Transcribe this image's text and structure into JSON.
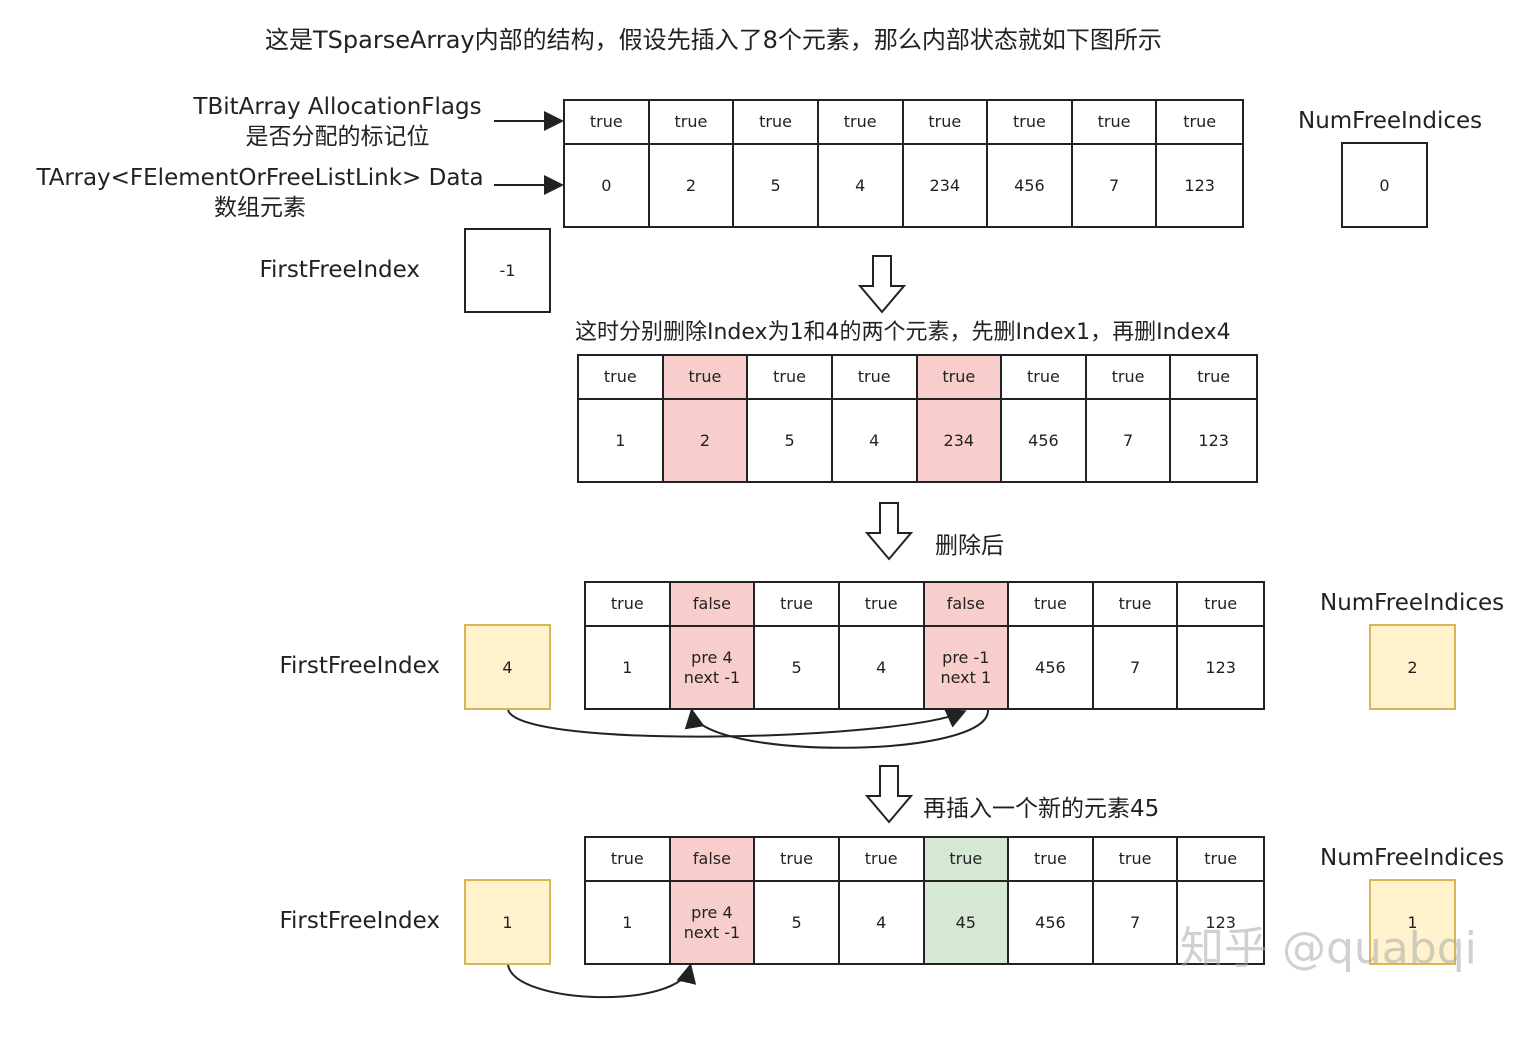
{
  "title": "这是TSparseArray内部的结构，假设先插入了8个元素，那么内部状态就如下图所示",
  "labels": {
    "alloc_flags_line1": "TBitArray AllocationFlags",
    "alloc_flags_line2": "是否分配的标记位",
    "data_line1": "TArray<FElementOrFreeListLink> Data",
    "data_line2": "数组元素",
    "first_free_index": "FirstFreeIndex",
    "num_free_indices": "NumFreeIndices",
    "step1": "这时分别删除Index为1和4的两个元素，先删Index1，再删Index4",
    "step2": "删除后",
    "step3": "再插入一个新的元素45"
  },
  "colors": {
    "removed": "#f8cecc",
    "inserted": "#d5e8d4",
    "free_index": "#fff2cc"
  },
  "states": [
    {
      "flags": [
        "true",
        "true",
        "true",
        "true",
        "true",
        "true",
        "true",
        "true"
      ],
      "data": [
        "0",
        "2",
        "5",
        "4",
        "234",
        "456",
        "7",
        "123"
      ],
      "first_free_index": "-1",
      "num_free_indices": "0"
    },
    {
      "flags": [
        "true",
        "true",
        "true",
        "true",
        "true",
        "true",
        "true",
        "true"
      ],
      "data": [
        "1",
        "2",
        "5",
        "4",
        "234",
        "456",
        "7",
        "123"
      ],
      "highlight_removed": [
        1,
        4
      ]
    },
    {
      "flags": [
        "true",
        "false",
        "true",
        "true",
        "false",
        "true",
        "true",
        "true"
      ],
      "data": [
        "1",
        "pre 4\nnext -1",
        "5",
        "4",
        "pre -1\nnext 1",
        "456",
        "7",
        "123"
      ],
      "first_free_index": "4",
      "num_free_indices": "2",
      "highlight_removed": [
        1,
        4
      ]
    },
    {
      "flags": [
        "true",
        "false",
        "true",
        "true",
        "true",
        "true",
        "true",
        "true"
      ],
      "data": [
        "1",
        "pre 4\nnext -1",
        "5",
        "4",
        "45",
        "456",
        "7",
        "123"
      ],
      "first_free_index": "1",
      "num_free_indices": "1",
      "highlight_removed": [
        1
      ],
      "highlight_inserted": [
        4
      ]
    }
  ],
  "watermark": "知乎 @quabqi"
}
